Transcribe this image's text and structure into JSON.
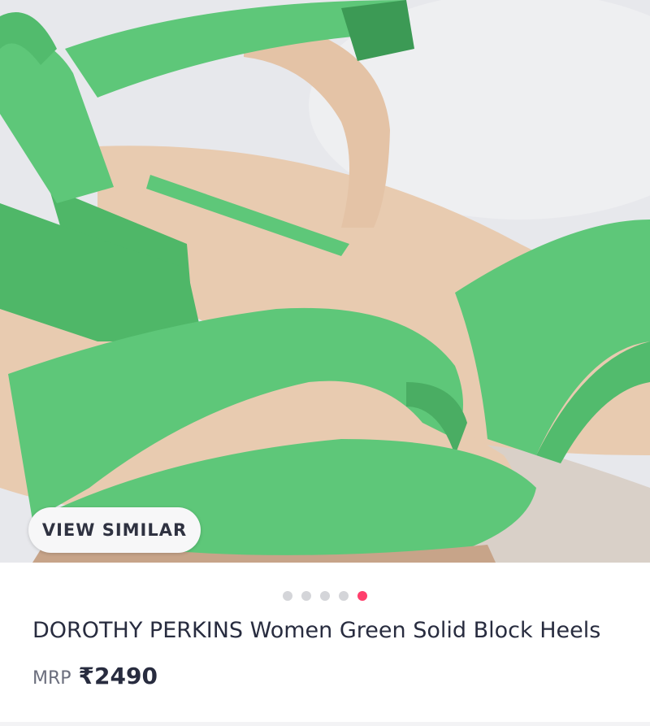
{
  "product_gallery": {
    "view_similar_label": "VIEW SIMILAR",
    "image_count": 5,
    "active_image_index": 4,
    "active_dot_color": "#ff3f6c",
    "inactive_dot_color": "#d4d5d9"
  },
  "product": {
    "title": "DOROTHY PERKINS Women Green Solid Block Heels",
    "mrp_label": "MRP",
    "price": "₹2490"
  },
  "colors": {
    "sandal_green": "#5ec779",
    "insole_beige": "#e9cdb3",
    "text_primary": "#282c3f"
  }
}
